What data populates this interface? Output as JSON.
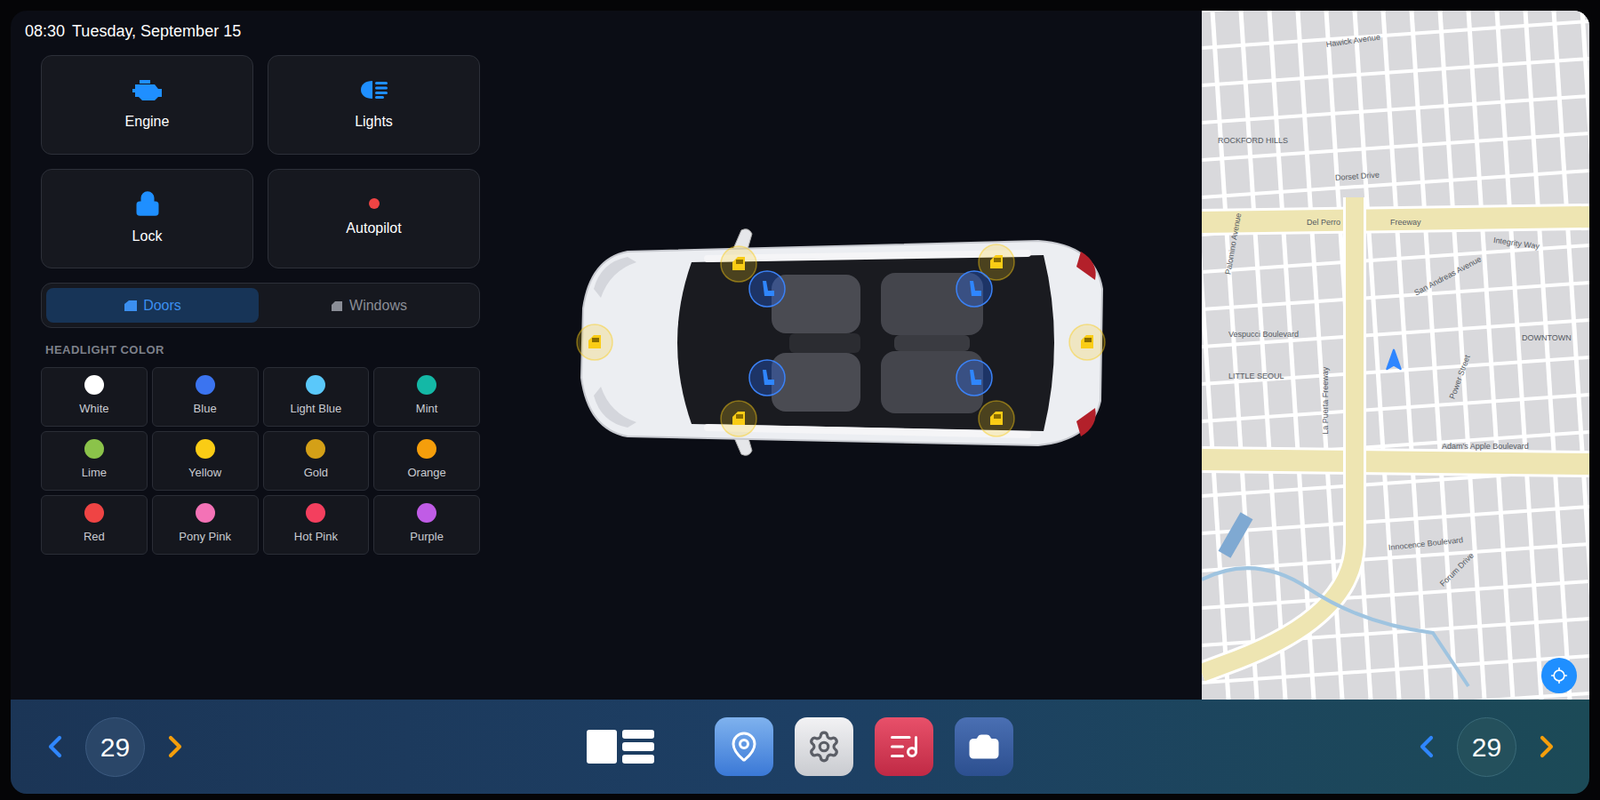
{
  "status_bar": {
    "time": "08:30",
    "date": "Tuesday, September 15"
  },
  "controls": [
    {
      "label": "Engine",
      "kind": "engine",
      "active": true
    },
    {
      "label": "Lights",
      "kind": "lights",
      "active": true
    },
    {
      "label": "Lock",
      "kind": "lock",
      "active": true
    },
    {
      "label": "Autopilot",
      "kind": "autopilot",
      "active": false
    }
  ],
  "tabs": [
    {
      "label": "Doors",
      "selected": true
    },
    {
      "label": "Windows",
      "selected": false
    }
  ],
  "headlight_color": {
    "title": "HEADLIGHT COLOR",
    "options": [
      {
        "name": "White",
        "color": "#ffffff"
      },
      {
        "name": "Blue",
        "color": "#3b74f0"
      },
      {
        "name": "Light Blue",
        "color": "#5ac8fa"
      },
      {
        "name": "Mint",
        "color": "#14b8a6"
      },
      {
        "name": "Lime",
        "color": "#8bc34a"
      },
      {
        "name": "Yellow",
        "color": "#facc15"
      },
      {
        "name": "Gold",
        "color": "#d4a017"
      },
      {
        "name": "Orange",
        "color": "#f59e0b"
      },
      {
        "name": "Red",
        "color": "#ef4444"
      },
      {
        "name": "Pony Pink",
        "color": "#f472b6"
      },
      {
        "name": "Hot Pink",
        "color": "#f43f5e"
      },
      {
        "name": "Purple",
        "color": "#c05ce6"
      }
    ]
  },
  "map": {
    "labels": [
      "Hawick Avenue",
      "ROCKFORD HILLS",
      "Dorset Drive",
      "Del Perro",
      "Freeway",
      "Integrity Way",
      "San Andreas Avenue",
      "Vespucci Boulevard",
      "LITTLE SEOUL",
      "La Puerta Freeway",
      "Power Street",
      "DOWNTOWN",
      "Adam's Apple Boulevard",
      "Innocence Boulevard",
      "Forum Drive",
      "Palomino Avenue"
    ]
  },
  "dock": {
    "left_temp": "29",
    "right_temp": "29"
  }
}
